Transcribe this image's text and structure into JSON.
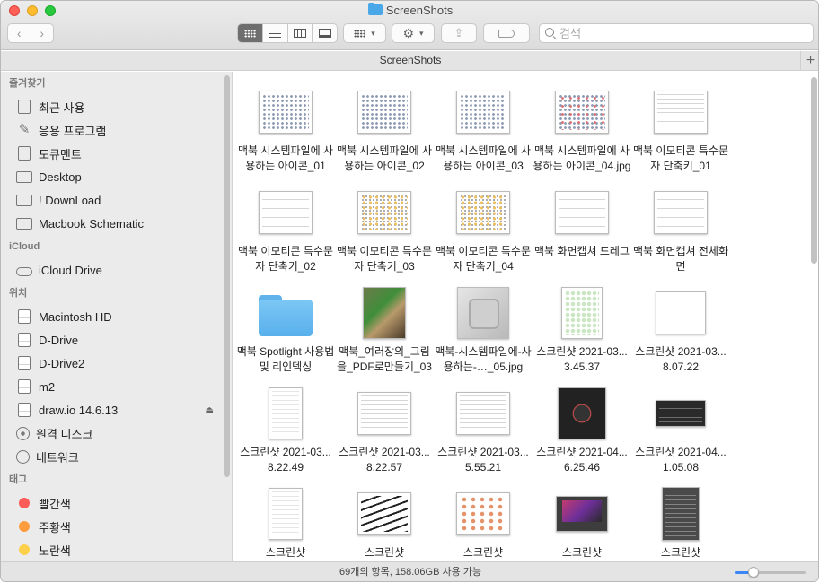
{
  "window": {
    "title": "ScreenShots"
  },
  "toolbar": {
    "back_icon": "chevron-left-icon",
    "forward_icon": "chevron-right-icon",
    "group_icon": "grid-group-icon",
    "action_icon": "gear-icon",
    "share_icon": "share-icon",
    "tag_icon": "tag-icon",
    "search_placeholder": "검색"
  },
  "pathbar": {
    "label": "ScreenShots"
  },
  "sidebar": {
    "sections": [
      {
        "title": "즐겨찾기",
        "items": [
          {
            "label": "최근 사용",
            "icon": "recent-icon"
          },
          {
            "label": "응용 프로그램",
            "icon": "applications-icon"
          },
          {
            "label": "도큐멘트",
            "icon": "document-icon"
          },
          {
            "label": "Desktop",
            "icon": "desktop-icon"
          },
          {
            "label": "! DownLoad",
            "icon": "folder-icon"
          },
          {
            "label": "Macbook Schematic",
            "icon": "folder-icon"
          }
        ]
      },
      {
        "title": "iCloud",
        "items": [
          {
            "label": "iCloud Drive",
            "icon": "cloud-icon"
          }
        ]
      },
      {
        "title": "위치",
        "items": [
          {
            "label": "Macintosh HD",
            "icon": "disk-icon"
          },
          {
            "label": "D-Drive",
            "icon": "disk-icon"
          },
          {
            "label": "D-Drive2",
            "icon": "disk-icon"
          },
          {
            "label": "m2",
            "icon": "disk-icon"
          },
          {
            "label": "draw.io 14.6.13",
            "icon": "disk-icon"
          },
          {
            "label": "원격 디스크",
            "icon": "disc-icon"
          },
          {
            "label": "네트워크",
            "icon": "network-icon"
          }
        ]
      },
      {
        "title": "태그",
        "items": [
          {
            "label": "빨간색",
            "icon": "tag-dot-icon",
            "color": "#fc5b57"
          },
          {
            "label": "주황색",
            "icon": "tag-dot-icon",
            "color": "#fd9c3c"
          },
          {
            "label": "노란색",
            "icon": "tag-dot-icon",
            "color": "#fdd04c"
          }
        ]
      }
    ]
  },
  "files": [
    {
      "name": "맥북 시스템파일에 사용하는 아이콘_01",
      "kind": "shot"
    },
    {
      "name": "맥북 시스템파일에 사용하는 아이콘_02",
      "kind": "shot"
    },
    {
      "name": "맥북 시스템파일에 사용하는 아이콘_03",
      "kind": "shot"
    },
    {
      "name": "맥북 시스템파일에 사용하는 아이콘_04.jpg",
      "kind": "red"
    },
    {
      "name": "맥북 이모티콘 특수문자 단축키_01",
      "kind": "plain"
    },
    {
      "name": "맥북 이모티콘 특수문자 단축키_02",
      "kind": "plain"
    },
    {
      "name": "맥북 이모티콘 특수문자 단축키_03",
      "kind": "emoji"
    },
    {
      "name": "맥북 이모티콘 특수문자 단축키_04",
      "kind": "emoji"
    },
    {
      "name": "맥북 화면캡쳐 드레그",
      "kind": "plain"
    },
    {
      "name": "맥북 화면캡쳐 전체화면",
      "kind": "plain"
    },
    {
      "name": "맥북 Spotlight 사용법 및 리인덱싱",
      "kind": "folder"
    },
    {
      "name": "맥북_여러장의_그림을_PDF로만들기_03",
      "kind": "photo"
    },
    {
      "name": "맥북-시스템파일에-사용하는-…_05.jpg",
      "kind": "mac"
    },
    {
      "name": "스크린샷 2021-03...3.45.37",
      "kind": "phone"
    },
    {
      "name": "스크린샷 2021-03...8.07.22",
      "kind": "hand"
    },
    {
      "name": "스크린샷 2021-03...8.22.49",
      "kind": "tall"
    },
    {
      "name": "스크린샷 2021-03...8.22.57",
      "kind": "plain"
    },
    {
      "name": "스크린샷 2021-03...5.55.21",
      "kind": "plain"
    },
    {
      "name": "스크린샷 2021-04...6.25.46",
      "kind": "watch"
    },
    {
      "name": "스크린샷 2021-04...1.05.08",
      "kind": "dark"
    },
    {
      "name": "스크린샷",
      "kind": "tall"
    },
    {
      "name": "스크린샷",
      "kind": "pens"
    },
    {
      "name": "스크린샷",
      "kind": "web"
    },
    {
      "name": "스크린샷",
      "kind": "laptop"
    },
    {
      "name": "스크린샷",
      "kind": "darkdoc"
    }
  ],
  "status": {
    "text": "69개의 항목, 158.06GB 사용 가능",
    "icon_size_fraction": 0.25
  }
}
